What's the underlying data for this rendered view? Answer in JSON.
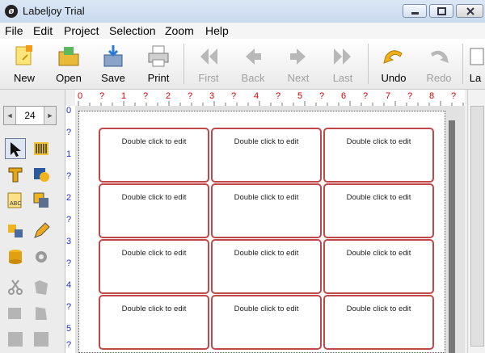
{
  "window": {
    "title": "Labeljoy Trial",
    "logo_text": "ø"
  },
  "menu": [
    "File",
    "Edit",
    "Project",
    "Selection",
    "Zoom",
    "Help"
  ],
  "toolbar": {
    "new": "New",
    "open": "Open",
    "save": "Save",
    "print": "Print",
    "first": "First",
    "back": "Back",
    "next": "Next",
    "last": "Last",
    "undo": "Undo",
    "redo": "Redo",
    "layout": "La"
  },
  "zoom": {
    "value": "24",
    "left_arrow": "◄",
    "right_arrow": "►"
  },
  "ruler": {
    "horizontal": [
      "0",
      "?",
      "1",
      "?",
      "2",
      "?",
      "3",
      "?",
      "4",
      "?",
      "5",
      "?",
      "6",
      "?",
      "7",
      "?",
      "8",
      "?"
    ],
    "vertical": [
      "0",
      "?",
      "1",
      "?",
      "2",
      "?",
      "3",
      "?",
      "4",
      "?",
      "5",
      "?"
    ]
  },
  "labels": [
    "Double click to edit",
    "Double click to edit",
    "Double click to edit",
    "Double click to edit",
    "Double click to edit",
    "Double click to edit",
    "Double click to edit",
    "Double click to edit",
    "Double click to edit",
    "Double click to edit",
    "Double click to edit",
    "Double click to edit"
  ],
  "colors": {
    "ruler_horizontal": "#d20000",
    "ruler_vertical": "#1b2fd6",
    "label_border": "#c14848"
  }
}
